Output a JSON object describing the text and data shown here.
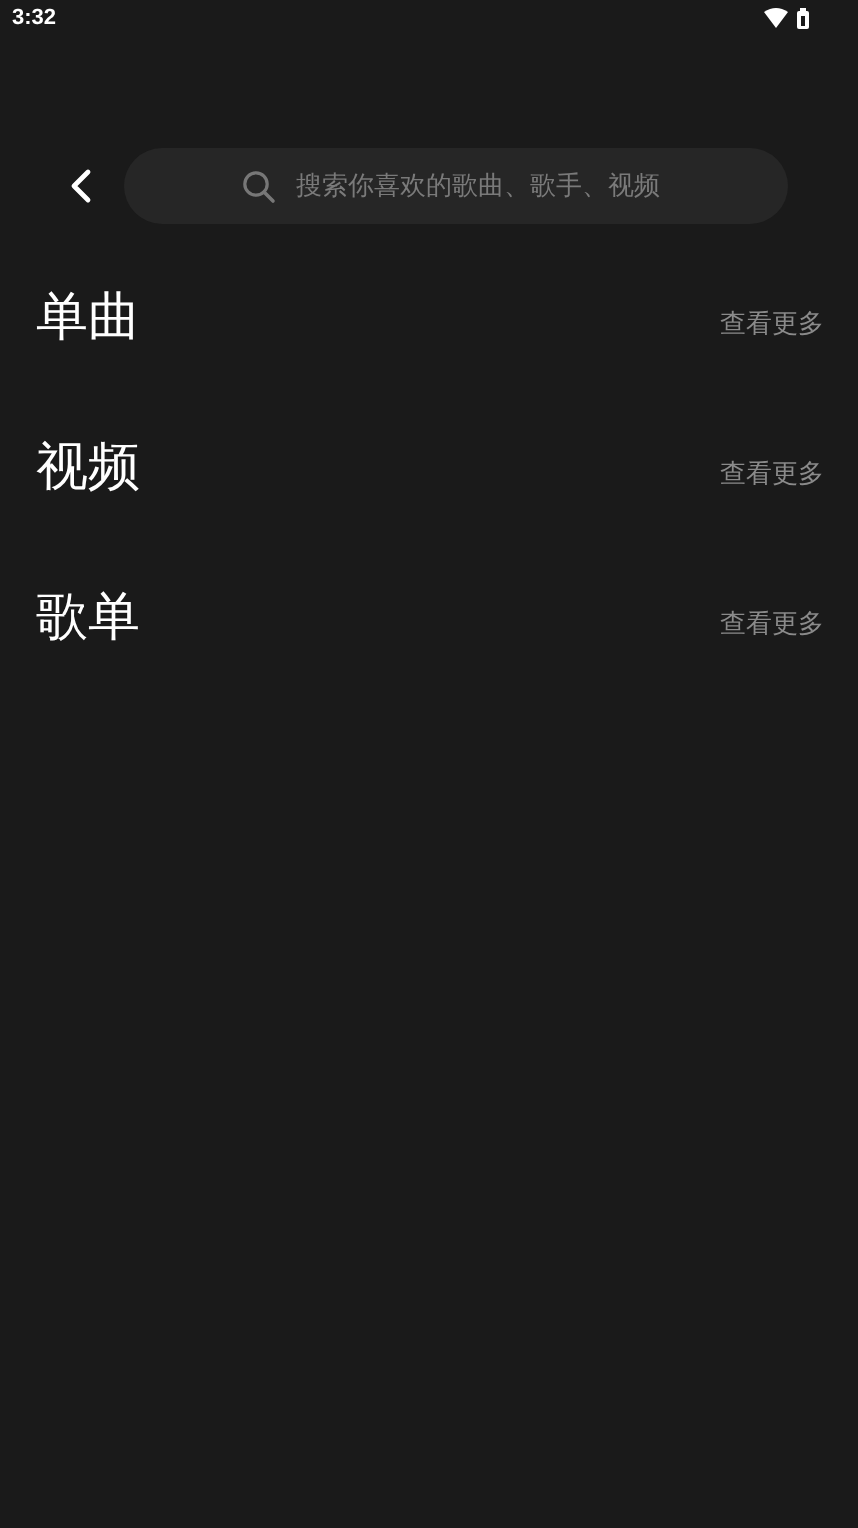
{
  "status_bar": {
    "time": "3:32"
  },
  "search": {
    "placeholder": "搜索你喜欢的歌曲、歌手、视频"
  },
  "sections": [
    {
      "title": "单曲",
      "more": "查看更多"
    },
    {
      "title": "视频",
      "more": "查看更多"
    },
    {
      "title": "歌单",
      "more": "查看更多"
    }
  ]
}
